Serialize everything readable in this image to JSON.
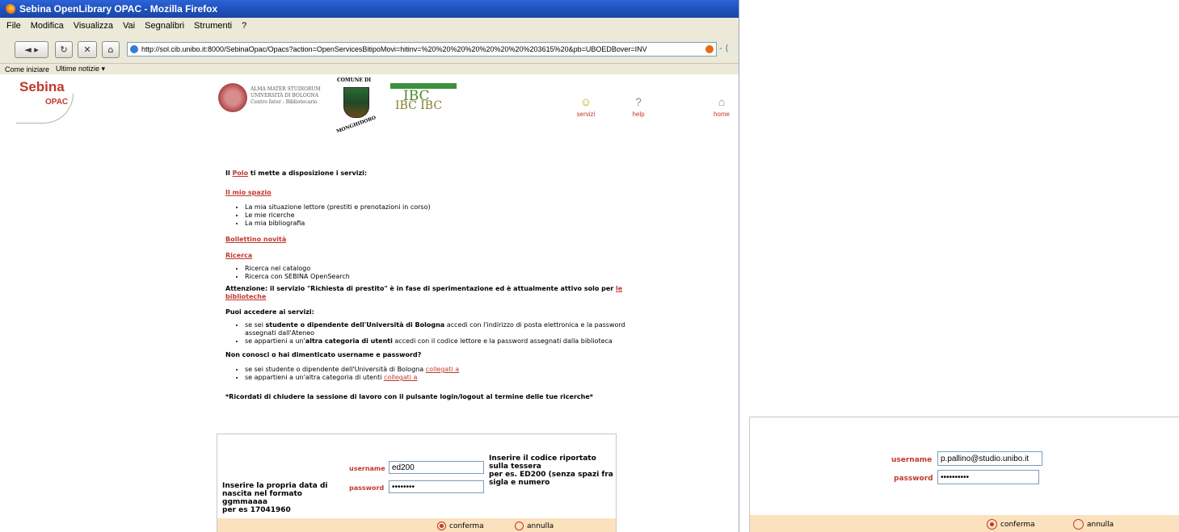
{
  "window": {
    "title": "Sebina OpenLibrary OPAC - Mozilla Firefox"
  },
  "menu": [
    "File",
    "Modifica",
    "Visualizza",
    "Vai",
    "Segnalibri",
    "Strumenti",
    "?"
  ],
  "toolbar": {
    "back": "◄ ▸",
    "reload": "↻",
    "stop": "✕",
    "home": "⌂",
    "url": "http://sol.cib.unibo.it:8000/SebinaOpac/Opacs?action=OpenServicesBitipoMovi=hitinv=%20%20%20%20%20%20%20%203615%20&pb=UBOEDBover=INV",
    "search_glyph": "- ("
  },
  "bookmarks": [
    "Come iniziare",
    "Ultime notizie ▾"
  ],
  "header": {
    "logo_line1": "Sebina",
    "logo_line2": "OPAC",
    "unibo_text": [
      "ALMA MATER STUDIORUM",
      "UNIVERSITÀ DI BOLOGNA",
      "Centro Inter - Bibliotecario"
    ],
    "comune_top": "COMUNE DI",
    "comune_bottom": "MONGHIDORO",
    "ibc_top": "IBC",
    "ibc_bottom": "IBC IBC",
    "nav": [
      {
        "label": "servizi",
        "icon": "☺"
      },
      {
        "label": "help",
        "icon": "?"
      },
      {
        "label": "home",
        "icon": "⌂"
      }
    ]
  },
  "content": {
    "intro_pre": "Il ",
    "intro_link": "Polo",
    "intro_post": " ti mette a disposizione i servizi:",
    "mio_spazio": "Il mio spazio",
    "mio_spazio_items": [
      "La mia situazione lettore (prestiti e prenotazioni in corso)",
      "Le mie ricerche",
      "La mia bibliografia"
    ],
    "bollettino": "Bollettino novità",
    "ricerca": "Ricerca",
    "ricerca_items": [
      "Ricerca nel catalogo",
      "Ricerca con SEBINA OpenSearch"
    ],
    "attenzione": "Attenzione: il servizio \"Richiesta di prestito\" è in fase di sperimentazione ed è attualmente attivo solo per",
    "attenzione_link": "le biblioteche",
    "puoi": "Puoi accedere ai servizi:",
    "puoi_1_pre": "se sei ",
    "puoi_1_bold": "studente o dipendente dell'Università di Bologna",
    "puoi_1_post": " accedi con l'indirizzo di posta elettronica e la password assegnati dall'Ateneo",
    "puoi_2_pre": "se appartieni a un'",
    "puoi_2_bold": "altra categoria di utenti",
    "puoi_2_post": " accedi con il codice lettore e la password assegnati dalla biblioteca",
    "non_conosci": "Non conosci o hai dimenticato username e password?",
    "nc_1_pre": "se sei studente o dipendente dell'Università di Bologna ",
    "nc_2_pre": "se appartieni a un'altra categoria di utenti ",
    "nc_link": "collegati a",
    "ricordati": "*Ricordati di chiudere la sessione di lavoro con il pulsante login/logout al termine delle tue ricerche*"
  },
  "form1": {
    "username_label": "username",
    "username_value": "ed200",
    "password_label": "password",
    "password_value": "••••••••",
    "note_right": [
      "Inserire il codice riportato sulla tessera",
      "per es. ED200 (senza spazi fra sigla e numero"
    ],
    "note_left": [
      "Inserire la propria data di",
      "nascita nel formato",
      "ggmmaaaa",
      "per es 17041960"
    ],
    "confirm": "conferma",
    "cancel": "annulla"
  },
  "form2": {
    "username_label": "username",
    "username_value": "p.pallino@studio.unibo.it",
    "password_label": "password",
    "password_value": "••••••••••",
    "confirm": "conferma",
    "cancel": "annulla"
  }
}
